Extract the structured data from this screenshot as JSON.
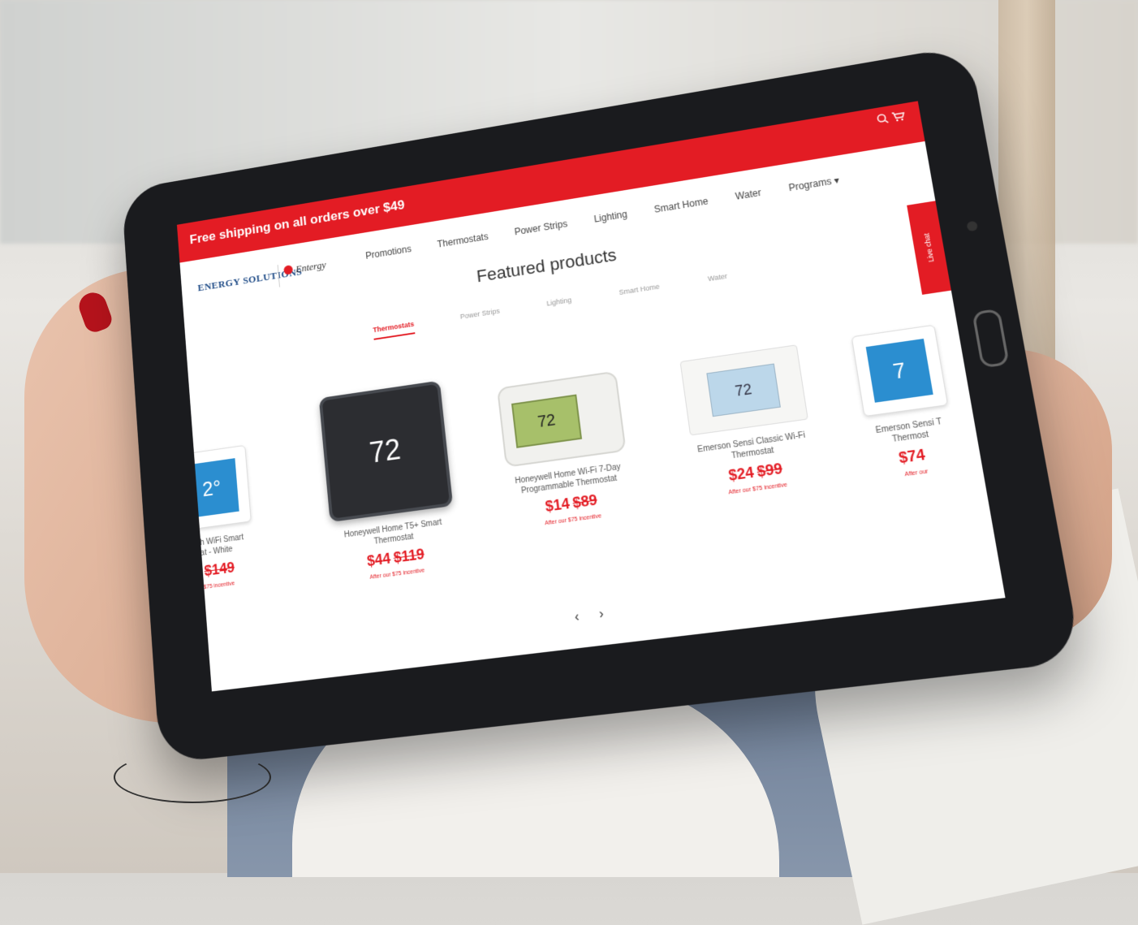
{
  "promo": {
    "text": "Free shipping on all orders over $49"
  },
  "header": {
    "logo_es": "ENERGY SOLUTIONS",
    "logo_entergy": "Entergy",
    "nav": [
      "Promotions",
      "Thermostats",
      "Power Strips",
      "Lighting",
      "Smart Home",
      "Water",
      "Programs ▾"
    ]
  },
  "icons": {
    "search": "search-icon",
    "cart": "cart-icon"
  },
  "featured": {
    "title": "Featured products",
    "categories": [
      "Thermostats",
      "Power Strips",
      "Lighting",
      "Smart Home",
      "Water"
    ],
    "active_category": "Thermostats"
  },
  "chat": {
    "label": "Live chat"
  },
  "products": [
    {
      "name": "ouch WiFi Smart\nat - White",
      "price_new": "",
      "price_old": "$149",
      "incentive": "$75 incentive",
      "display": "2°"
    },
    {
      "name": "Honeywell Home T5+ Smart\nThermostat",
      "price_new": "$44",
      "price_old": "$119",
      "incentive": "After our $75 incentive",
      "display": "72"
    },
    {
      "name": "Honeywell Home Wi-Fi 7-Day\nProgrammable Thermostat",
      "price_new": "$14",
      "price_old": "$89",
      "incentive": "After our $75 incentive",
      "display": "72"
    },
    {
      "name": "Emerson Sensi Classic Wi-Fi\nThermostat",
      "price_new": "$24",
      "price_old": "$99",
      "incentive": "After our $75 incentive",
      "display": "72"
    },
    {
      "name": "Emerson Sensi T\nThermost",
      "price_new": "$74",
      "price_old": "",
      "incentive": "After our",
      "display": "7"
    }
  ],
  "carousel": {
    "prev": "‹",
    "next": "›"
  },
  "colors": {
    "brand_red": "#e31c24"
  }
}
